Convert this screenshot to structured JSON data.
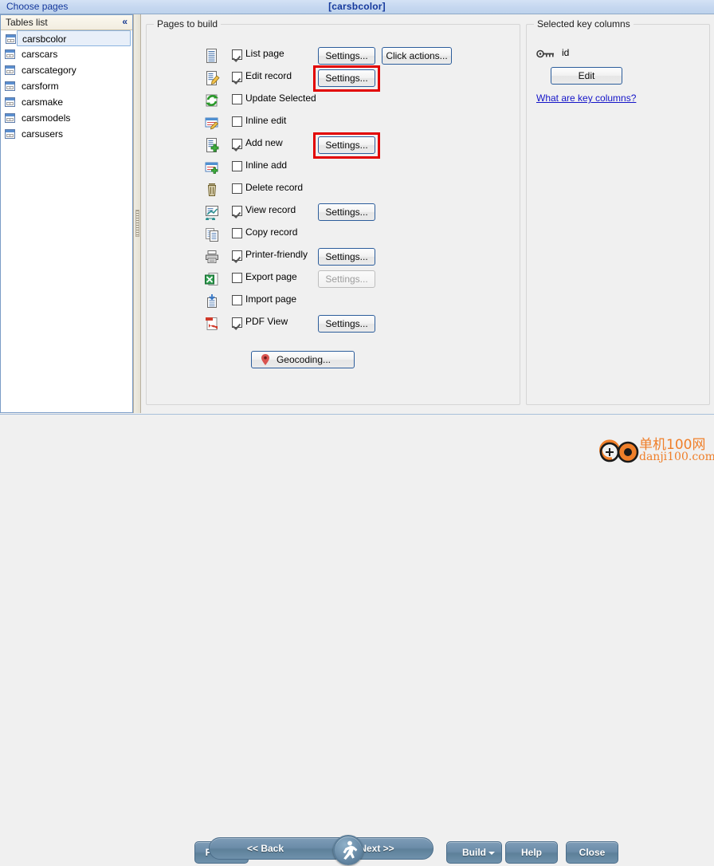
{
  "window": {
    "title": "[carsbcolor]",
    "header_label": "Choose pages"
  },
  "tables_panel": {
    "header": "Tables list",
    "collapse_icon": "chevron-double-left-icon",
    "items": [
      {
        "label": "carsbcolor",
        "selected": true
      },
      {
        "label": "carscars",
        "selected": false
      },
      {
        "label": "carscategory",
        "selected": false
      },
      {
        "label": "carsform",
        "selected": false
      },
      {
        "label": "carsmake",
        "selected": false
      },
      {
        "label": "carsmodels",
        "selected": false
      },
      {
        "label": "carsusers",
        "selected": false
      }
    ]
  },
  "pages_group": {
    "title": "Pages to build",
    "rows": [
      {
        "label": "List page",
        "icon": "list-page-icon",
        "checked": true,
        "settings": "Settings...",
        "settings_enabled": true,
        "highlighted": false,
        "extra_button": "Click actions..."
      },
      {
        "label": "Edit record",
        "icon": "edit-record-icon",
        "checked": true,
        "settings": "Settings...",
        "settings_enabled": true,
        "highlighted": true
      },
      {
        "label": "Update Selected",
        "icon": "update-selected-icon",
        "checked": false
      },
      {
        "label": "Inline edit",
        "icon": "inline-edit-icon",
        "checked": false
      },
      {
        "label": "Add new",
        "icon": "add-new-icon",
        "checked": true,
        "settings": "Settings...",
        "settings_enabled": true,
        "highlighted": true
      },
      {
        "label": "Inline add",
        "icon": "inline-add-icon",
        "checked": false
      },
      {
        "label": "Delete record",
        "icon": "delete-record-icon",
        "checked": false
      },
      {
        "label": "View record",
        "icon": "view-record-icon",
        "checked": true,
        "settings": "Settings...",
        "settings_enabled": true,
        "highlighted": false
      },
      {
        "label": "Copy record",
        "icon": "copy-record-icon",
        "checked": false
      },
      {
        "label": "Printer-friendly",
        "icon": "printer-icon",
        "checked": true,
        "settings": "Settings...",
        "settings_enabled": true,
        "highlighted": false
      },
      {
        "label": "Export page",
        "icon": "export-page-icon",
        "checked": false,
        "settings": "Settings...",
        "settings_enabled": false,
        "highlighted": false
      },
      {
        "label": "Import page",
        "icon": "import-page-icon",
        "checked": false
      },
      {
        "label": "PDF View",
        "icon": "pdf-view-icon",
        "checked": true,
        "settings": "Settings...",
        "settings_enabled": true,
        "highlighted": false
      }
    ],
    "geocoding_button": "Geocoding..."
  },
  "keys_group": {
    "title": "Selected key columns",
    "key_icon": "key-icon",
    "key_name": "id",
    "edit_button": "Edit",
    "help_link": "What are key columns?"
  },
  "bottom_bar": {
    "project": "Project",
    "back": "<< Back",
    "next": "Next >>",
    "run_icon": "run-person-icon",
    "build": "Build",
    "help": "Help",
    "close": "Close"
  },
  "watermark": {
    "cn": "单机100网",
    "en": "danji100.com"
  },
  "colors": {
    "accent": "#14389c",
    "highlight": "#e20000",
    "steel": "#6c8da9",
    "link": "#1414c8",
    "watermark": "#ef7f2a"
  }
}
